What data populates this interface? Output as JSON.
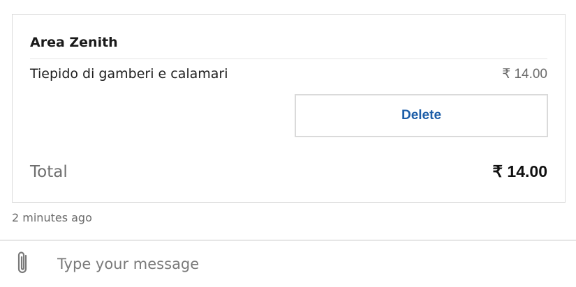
{
  "order_card": {
    "title": "Area Zenith",
    "item": {
      "name": "Tiepido di gamberi e calamari",
      "price": "₹ 14.00"
    },
    "delete_label": "Delete",
    "total_label": "Total",
    "total_value": "₹ 14.00"
  },
  "timestamp": "2 minutes ago",
  "composer": {
    "attach_icon": "paperclip-icon",
    "placeholder": "Type your message",
    "value": ""
  },
  "colors": {
    "accent": "#1d5ea8",
    "border": "#dcdcdc",
    "muted_text": "#6e6e6e"
  }
}
